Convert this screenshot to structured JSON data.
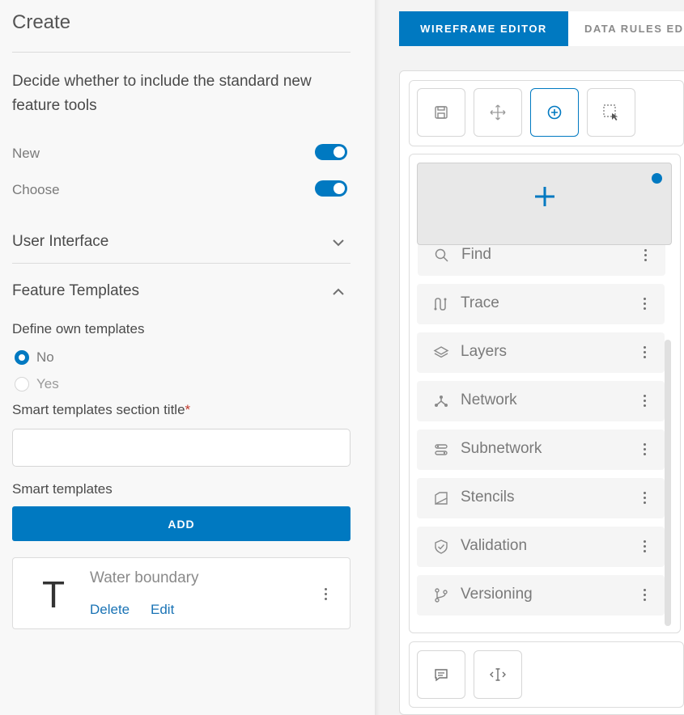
{
  "left_panel": {
    "title": "Create",
    "description": "Decide whether to include the standard new feature tools",
    "toggles": [
      {
        "label": "New",
        "on": true
      },
      {
        "label": "Choose",
        "on": true
      }
    ],
    "user_interface": {
      "title": "User Interface",
      "expanded": false
    },
    "feature_templates": {
      "title": "Feature Templates",
      "expanded": true,
      "define_label": "Define own templates",
      "options": [
        {
          "label": "No",
          "selected": true
        },
        {
          "label": "Yes",
          "selected": false
        }
      ],
      "section_title_label": "Smart templates section title",
      "required_mark": "*",
      "section_title_value": "",
      "smart_templates_label": "Smart templates",
      "add_button": "ADD",
      "template": {
        "glyph": "T",
        "name": "Water boundary",
        "delete": "Delete",
        "edit": "Edit"
      }
    }
  },
  "editor": {
    "tabs": [
      {
        "label": "WIREFRAME EDITOR",
        "active": true
      },
      {
        "label": "DATA RULES EDITOR",
        "active": false
      }
    ],
    "toolbar": [
      {
        "icon": "save-icon",
        "active": false
      },
      {
        "icon": "move-icon",
        "active": false
      },
      {
        "icon": "add-circle-icon",
        "active": true
      },
      {
        "icon": "select-icon",
        "active": false
      }
    ],
    "items": [
      {
        "label": "Find",
        "icon": "search-icon"
      },
      {
        "label": "Trace",
        "icon": "trace-icon"
      },
      {
        "label": "Layers",
        "icon": "layers-icon"
      },
      {
        "label": "Network",
        "icon": "network-icon"
      },
      {
        "label": "Subnetwork",
        "icon": "subnetwork-icon"
      },
      {
        "label": "Stencils",
        "icon": "stencils-icon"
      },
      {
        "label": "Validation",
        "icon": "shield-check-icon"
      },
      {
        "label": "Versioning",
        "icon": "branch-icon"
      }
    ],
    "bottom_toolbar": [
      {
        "icon": "comment-icon"
      },
      {
        "icon": "text-cursor-icon"
      }
    ],
    "accent_color": "#0079c1"
  }
}
